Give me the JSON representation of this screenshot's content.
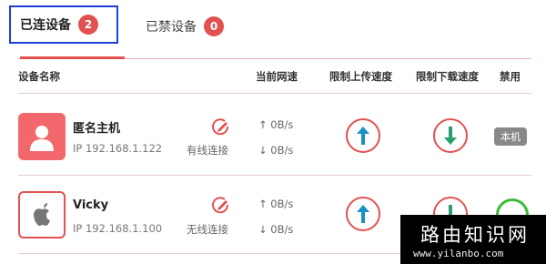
{
  "tabs": [
    {
      "label": "已连设备",
      "count": "2"
    },
    {
      "label": "已禁设备",
      "count": "0"
    }
  ],
  "table": {
    "headers": {
      "device_name": "设备名称",
      "current_speed": "当前网速",
      "limit_upload": "限制上传速度",
      "limit_download": "限制下载速度",
      "ban": "禁用"
    }
  },
  "devices": [
    {
      "name": "匿名主机",
      "ip": "IP 192.168.1.122",
      "connection": "有线连接",
      "upload": "↑ 0B/s",
      "download": "↓ 0B/s",
      "tag": "本机",
      "avatar_icon": "person-icon"
    },
    {
      "name": "Vicky",
      "ip": "IP 192.168.1.100",
      "connection": "无线连接",
      "upload": "↑ 0B/s",
      "download": "↓ 0B/s",
      "avatar_icon": "apple-icon"
    }
  ],
  "watermark": {
    "title": "路由知识网",
    "url": "www.yilanbo.com"
  },
  "colors": {
    "accent": "#e25151",
    "highlight_box": "#1d3fd8",
    "upload_arrow": "#1a8fc4",
    "download_arrow": "#2a9e6e",
    "toggle_on": "#3dbb37"
  }
}
